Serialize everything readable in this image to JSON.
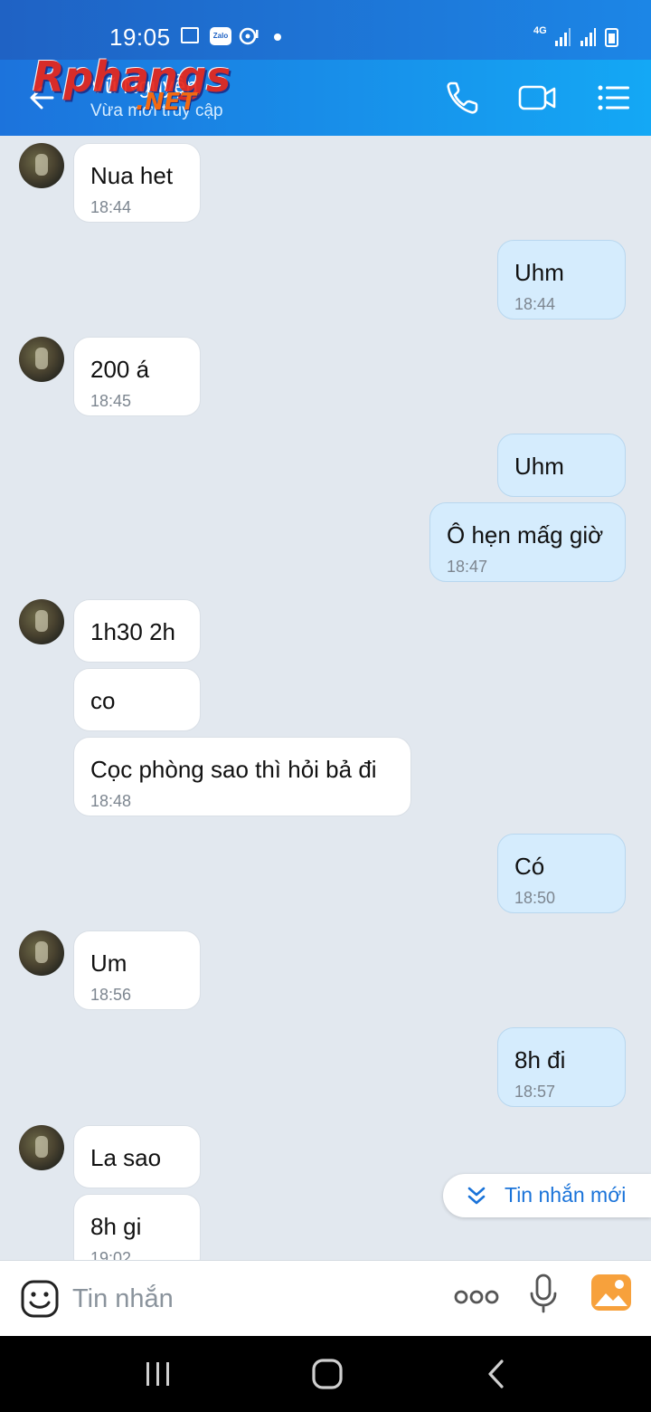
{
  "status_bar": {
    "time": "19:05",
    "network": "4G"
  },
  "header": {
    "contact_name": "Vũ Nguyễn",
    "contact_status": "Vừa mới truy cập",
    "watermark_main": "Rphangs",
    "watermark_sub": ".NET"
  },
  "messages": [
    {
      "dir": "in",
      "text": "Nua het",
      "time": "18:44"
    },
    {
      "dir": "out",
      "text": "Uhm",
      "time": "18:44"
    },
    {
      "dir": "in",
      "text": "200 á",
      "time": "18:45"
    },
    {
      "dir": "out",
      "text": "Uhm",
      "time": ""
    },
    {
      "dir": "out",
      "text": "Ô hẹn mấg giờ",
      "time": "18:47"
    },
    {
      "dir": "in",
      "text": "1h30 2h",
      "time": ""
    },
    {
      "dir": "in",
      "text": "co",
      "time": ""
    },
    {
      "dir": "in",
      "text": "Cọc phòng sao thì hỏi bả đi",
      "time": "18:48"
    },
    {
      "dir": "out",
      "text": "Có",
      "time": "18:50"
    },
    {
      "dir": "in",
      "text": "Um",
      "time": "18:56"
    },
    {
      "dir": "out",
      "text": "8h đi",
      "time": "18:57"
    },
    {
      "dir": "in",
      "text": "La sao",
      "time": ""
    },
    {
      "dir": "in",
      "text": "8h gi",
      "time": "19:02"
    }
  ],
  "new_messages_button": "Tin nhắn mới",
  "input": {
    "placeholder": "Tin nhắn"
  },
  "colors": {
    "header_start": "#1c73dc",
    "header_end": "#14a8f5",
    "outgoing_bubble": "#d5ecfd",
    "incoming_bubble": "#ffffff",
    "chat_background": "#e2e8ef",
    "accent": "#1a73d9"
  }
}
